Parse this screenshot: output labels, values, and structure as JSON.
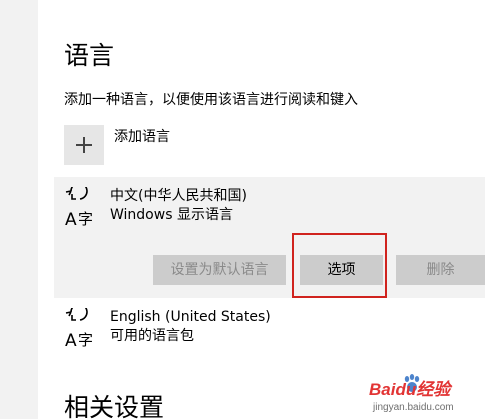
{
  "page": {
    "title": "语言",
    "description": "添加一种语言，以便使用该语言进行阅读和键入"
  },
  "add_language": {
    "label": "添加语言",
    "icon": "plus-icon"
  },
  "languages": [
    {
      "name": "中文(中华人民共和国)",
      "subtitle": "Windows 显示语言",
      "icon": "language-icon",
      "selected": true,
      "buttons": {
        "set_default": "设置为默认语言",
        "options": "选项",
        "remove": "删除"
      }
    },
    {
      "name": "English (United States)",
      "subtitle": "可用的语言包",
      "icon": "language-icon",
      "selected": false
    }
  ],
  "next_section": {
    "title_partial": "相关设置"
  },
  "watermark": {
    "logo": "Baidu经验",
    "url": "jingyan.baidu.com"
  },
  "colors": {
    "highlight": "#d0231e",
    "selected_row": "#f2f2f2",
    "button_bg": "#cccccc",
    "disabled_text": "#8a8a8a",
    "watermark_blue": "#2f6fc4"
  }
}
